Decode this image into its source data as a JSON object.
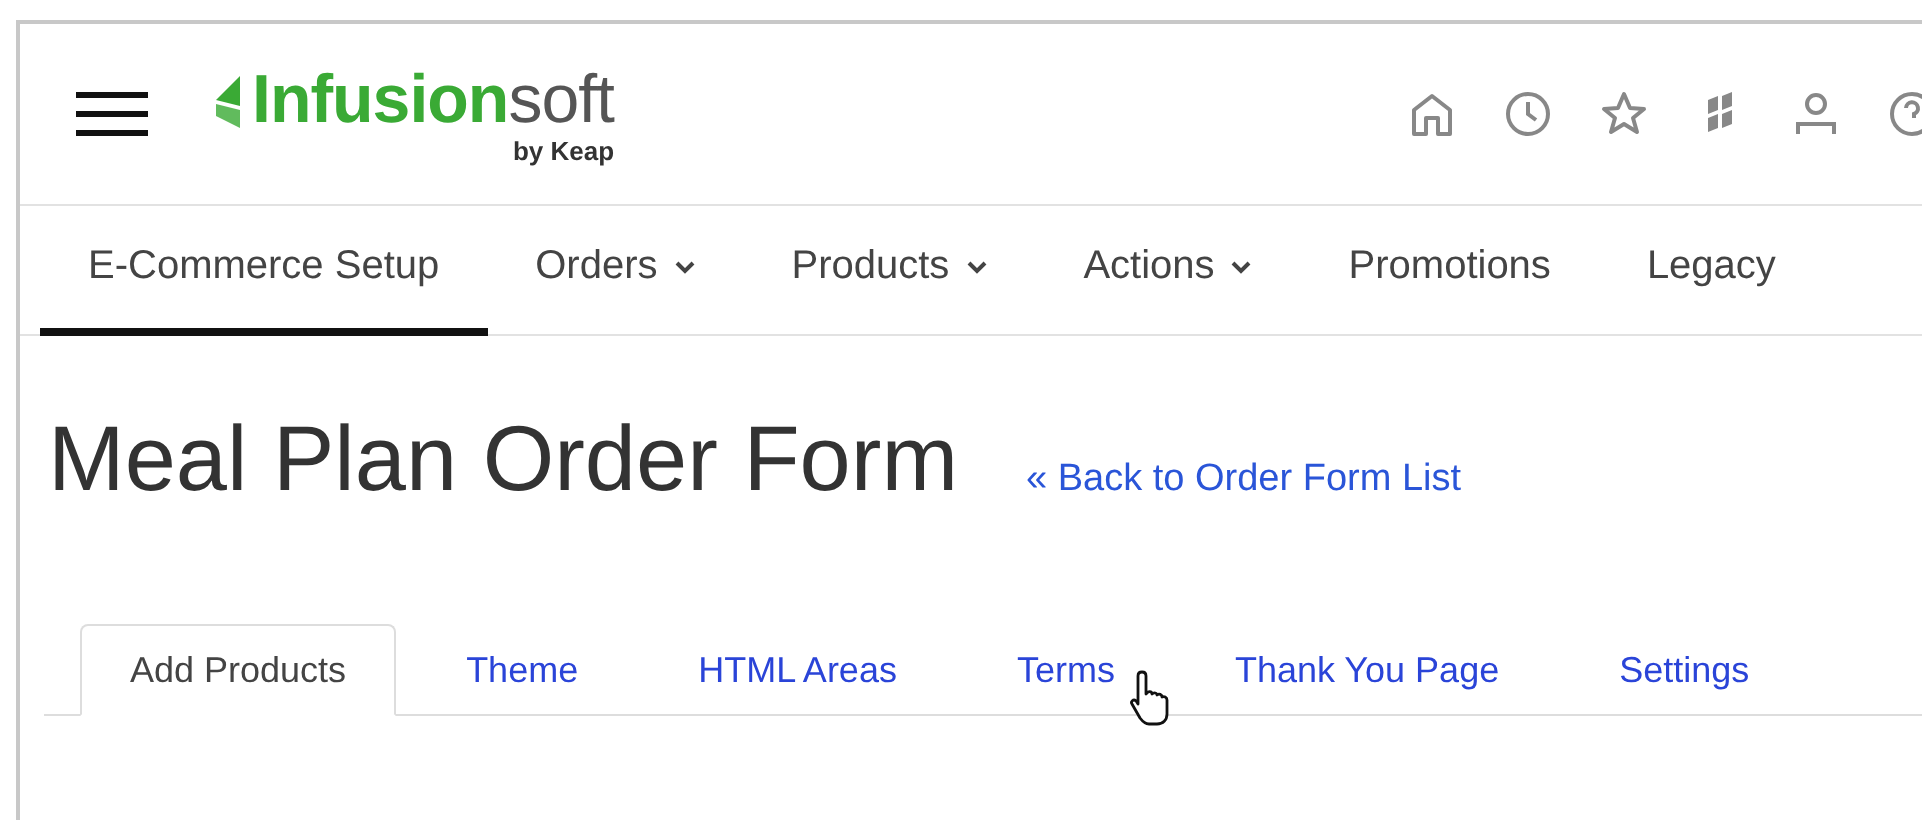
{
  "header": {
    "logo_main": "**Infusion**soft",
    "logo_sub": "by Keap"
  },
  "nav": [
    {
      "label": "E-Commerce Setup",
      "selected": true,
      "has_menu": false
    },
    {
      "label": "Orders",
      "selected": false,
      "has_menu": true
    },
    {
      "label": "Products",
      "selected": false,
      "has_menu": true
    },
    {
      "label": "Actions",
      "selected": false,
      "has_menu": true
    },
    {
      "label": "Promotions",
      "selected": false,
      "has_menu": false
    },
    {
      "label": "Legacy",
      "selected": false,
      "has_menu": false
    }
  ],
  "page": {
    "title": "Meal Plan Order Form",
    "back_link": "« Back to Order Form List"
  },
  "tabs": [
    {
      "label": "Add Products",
      "selected": true
    },
    {
      "label": "Theme",
      "selected": false
    },
    {
      "label": "HTML Areas",
      "selected": false
    },
    {
      "label": "Terms",
      "selected": false,
      "hovered": true
    },
    {
      "label": "Thank You Page",
      "selected": false
    },
    {
      "label": "Settings",
      "selected": false
    }
  ]
}
